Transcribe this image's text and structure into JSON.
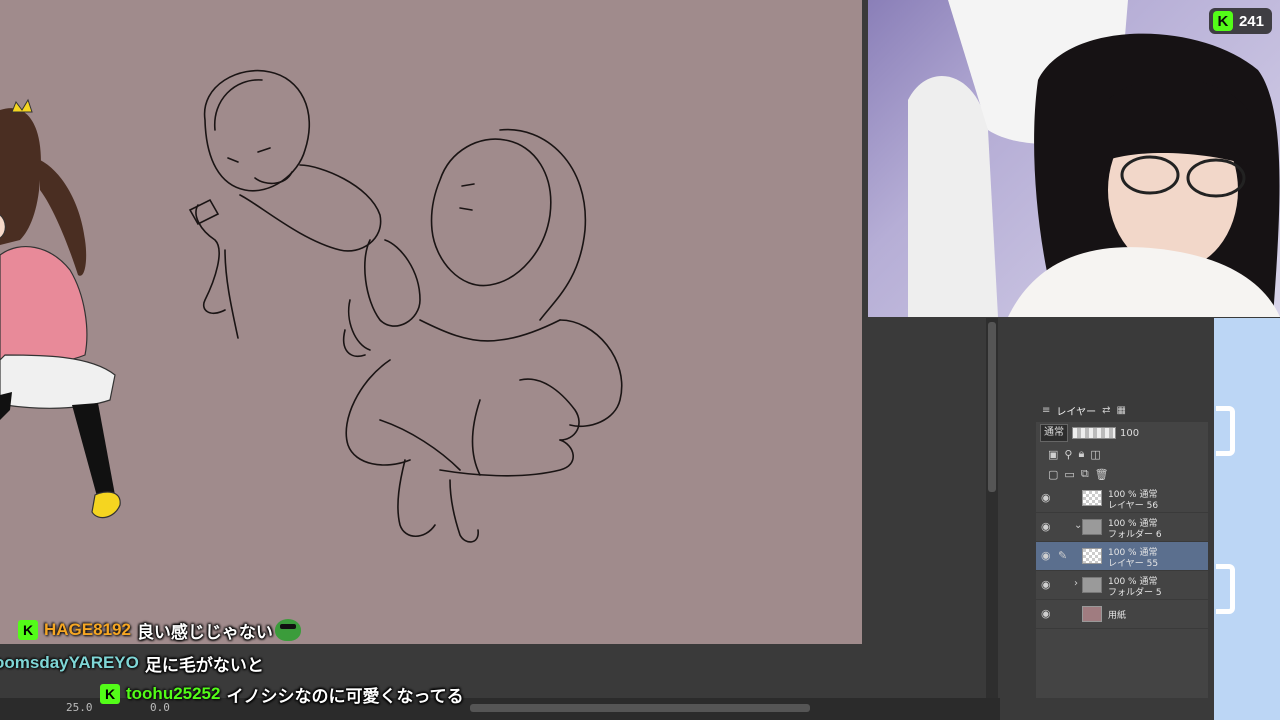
{
  "viewer_count": {
    "icon": "kick-logo-icon",
    "value": "241",
    "accent": "#53fc18"
  },
  "canvas": {
    "background": "#a08b8c"
  },
  "status_bar": {
    "zoom": "25.0",
    "angle": "0.0"
  },
  "layer_panel": {
    "tab_label": "レイヤー",
    "blend_mode": "通常",
    "opacity": "100",
    "layers": [
      {
        "opacity_mode": "100 % 通常",
        "name": "レイヤー 56",
        "type": "raster"
      },
      {
        "opacity_mode": "100 % 通常",
        "name": "フォルダー 6",
        "type": "folder",
        "expanded": true
      },
      {
        "opacity_mode": "100 % 通常",
        "name": "レイヤー 55",
        "type": "raster",
        "active": true
      },
      {
        "opacity_mode": "100 % 通常",
        "name": "フォルダー 5",
        "type": "folder",
        "expanded": false
      },
      {
        "opacity_mode": "",
        "name": "用紙",
        "type": "paper"
      }
    ]
  },
  "chat": [
    {
      "user": "HAGE8192",
      "user_color": "#f5a623",
      "message": "良い感じじゃない",
      "badge": true,
      "emote": "pepe-emote"
    },
    {
      "user": "oomsdayYAREYO",
      "user_color": "#7fd6d6",
      "message": "足に毛がないと",
      "badge": false
    },
    {
      "user": "toohu25252",
      "user_color": "#53fc18",
      "message": "イノシシなのに可愛くなってる",
      "badge": true
    }
  ]
}
